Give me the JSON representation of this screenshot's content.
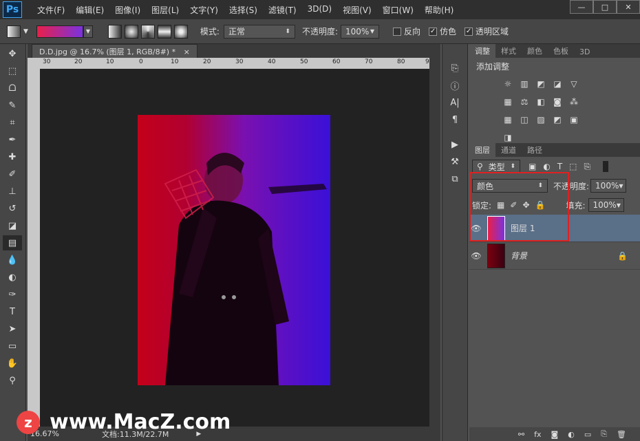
{
  "app": {
    "logo": "Ps"
  },
  "menu": [
    "文件(F)",
    "编辑(E)",
    "图像(I)",
    "图层(L)",
    "文字(Y)",
    "选择(S)",
    "滤镜(T)",
    "3D(D)",
    "视图(V)",
    "窗口(W)",
    "帮助(H)"
  ],
  "window_controls": [
    "—",
    "□",
    "✕"
  ],
  "options": {
    "mode_label": "模式:",
    "mode_value": "正常",
    "opacity_label": "不透明度:",
    "opacity_value": "100%",
    "reverse_label": "反向",
    "dither_label": "仿色",
    "transparency_label": "透明区域",
    "gradient_colors": [
      "#e8204a",
      "#7a32e0"
    ]
  },
  "document": {
    "tab_title": "D.D.jpg @ 16.7% (图层 1, RGB/8#) *",
    "ruler_ticks": [
      "30",
      "20",
      "10",
      "0",
      "10",
      "20",
      "30",
      "40",
      "50",
      "60",
      "70",
      "80",
      "90"
    ],
    "zoom": "16.67%",
    "doc_size": "文档:11.3M/22.7M"
  },
  "adjustments": {
    "tabs": [
      "调整",
      "样式",
      "颜色",
      "色板",
      "3D"
    ],
    "title": "添加调整",
    "icons": [
      "brightness-icon",
      "levels-icon",
      "curves-icon",
      "exposure-icon",
      "vibrance-icon",
      "hue-icon",
      "color-balance-icon",
      "bw-icon",
      "photo-filter-icon",
      "channel-mixer-icon",
      "color-lookup-icon",
      "invert-icon",
      "posterize-icon",
      "threshold-icon",
      "gradient-map-icon",
      "selective-color-icon"
    ]
  },
  "layers": {
    "tabs": [
      "图层",
      "通道",
      "路径"
    ],
    "filter_label": "类型",
    "blend_mode": "颜色",
    "opacity_label": "不透明度:",
    "opacity_value": "100%",
    "lock_label": "锁定:",
    "fill_label": "填充:",
    "fill_value": "100%",
    "items": [
      {
        "name": "图层 1",
        "selected": true
      },
      {
        "name": "背景",
        "selected": false
      }
    ]
  },
  "watermark": "www.MacZ.com"
}
